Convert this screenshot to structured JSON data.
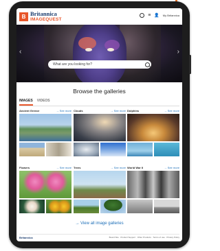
{
  "header": {
    "logo_mark": "B",
    "brand": "Britannica",
    "product": "IMAGEQUEST",
    "account_label": "My Britannica"
  },
  "hero": {
    "search_placeholder": "What are you looking for?"
  },
  "browse": {
    "title": "Browse the galleries",
    "tabs": [
      {
        "label": "IMAGES",
        "active": true
      },
      {
        "label": "VIDEOS",
        "active": false
      }
    ],
    "see_more_label": "→ See more",
    "galleries": [
      {
        "title": "Ancient Greece"
      },
      {
        "title": "Clouds"
      },
      {
        "title": "Dolphins"
      },
      {
        "title": "Flowers"
      },
      {
        "title": "Trees"
      },
      {
        "title": "World War II"
      }
    ],
    "view_all_label": "→ View all image galleries"
  },
  "footer": {
    "logo": "Britannica",
    "links": "Board Site · Product Support · Other Products · Terms of use · Privacy Policy"
  },
  "colors": {
    "accent": "#e8562a",
    "link": "#1d6fb8",
    "brand_navy": "#1b3c6e"
  }
}
